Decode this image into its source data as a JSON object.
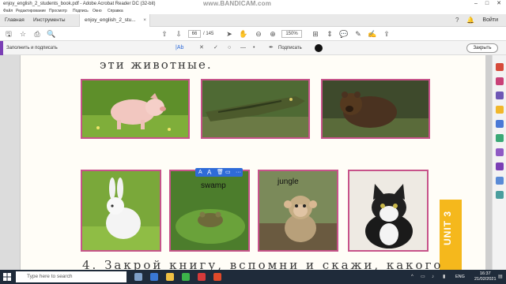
{
  "window": {
    "title": "enjoy_english_2_students_book.pdf - Adobe Acrobat Reader DC (32-bit)",
    "watermark": "www.BANDICAM.com",
    "minimize": "–",
    "maximize": "□",
    "close": "✕"
  },
  "menu": [
    "Файл",
    "Редактирование",
    "Просмотр",
    "Подпись",
    "Окно",
    "Справка"
  ],
  "tabs": {
    "home": "Главная",
    "tools": "Инструменты",
    "doc": "enjoy_english_2_stu...",
    "doc_close": "×",
    "signin": "Войти"
  },
  "toolbar": {
    "page_current": "66",
    "page_total": "/ 145",
    "zoom": "150%"
  },
  "fill_sign": {
    "label": "Заполнить и подписать",
    "text_tool": "|Ab",
    "sign_label": "Подписать",
    "close_label": "Закрыть"
  },
  "page": {
    "heading": "эти животные.",
    "heading2": "4. Закрой книгу, вспомни и скажи, какого",
    "unit_label": "UNIT 3",
    "annotations": {
      "swamp": "swamp",
      "jungle": "jungle"
    }
  },
  "photos": [
    {
      "name": "pig",
      "subject": "piglet on grass"
    },
    {
      "name": "crocodile",
      "subject": "crocodile in water"
    },
    {
      "name": "bear",
      "subject": "brown bear"
    },
    {
      "name": "rabbit",
      "subject": "white rabbit"
    },
    {
      "name": "frog",
      "subject": "frog on lily pad"
    },
    {
      "name": "monkey",
      "subject": "baby monkey"
    },
    {
      "name": "cat",
      "subject": "black and white cat"
    }
  ],
  "taskbar": {
    "search_placeholder": "Type here to search",
    "language": "ENG",
    "time": "16:37",
    "date": "21/02/2021"
  },
  "colors": {
    "accent": "#7b3fb5",
    "photo_border": "#c7538a",
    "unit_tab": "#f5b81c",
    "annotation_bar": "#2f6bd8",
    "taskbar": "#1f2b3a"
  }
}
